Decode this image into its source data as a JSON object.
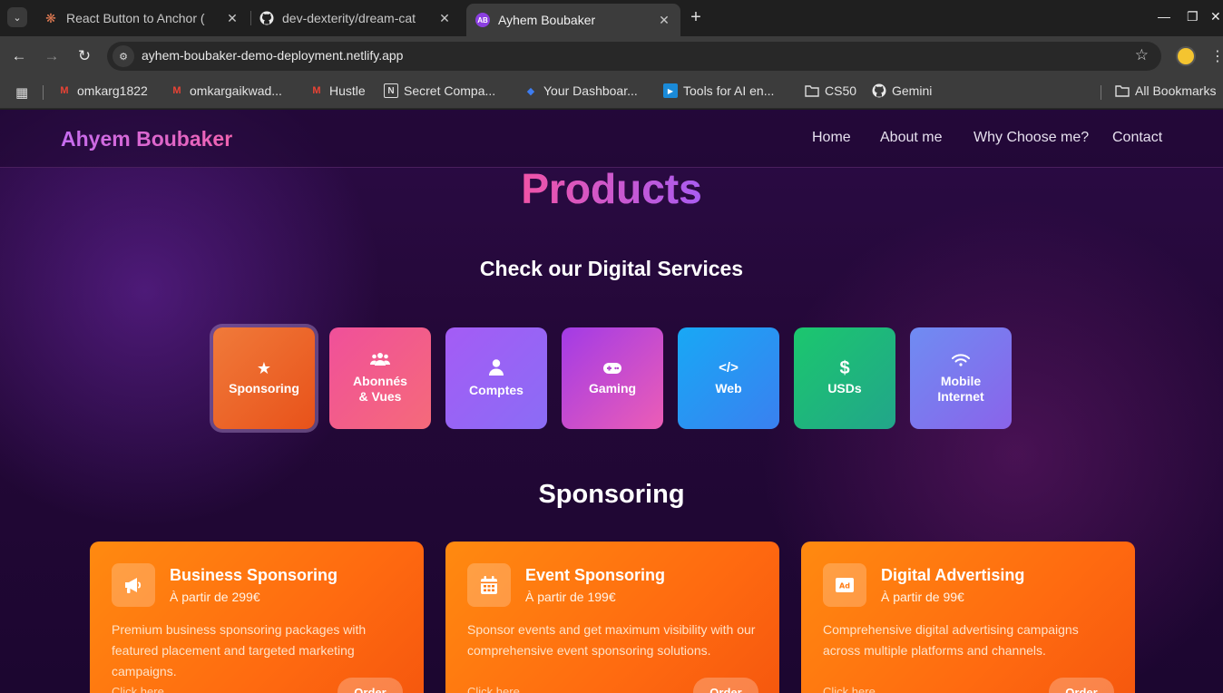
{
  "browser": {
    "tabs": [
      {
        "title": "React Button to Anchor (",
        "favicon": "claude-icon",
        "active": false
      },
      {
        "title": "dev-dexterity/dream-cat",
        "favicon": "github-icon",
        "active": false
      },
      {
        "title": "Ayhem Boubaker",
        "favicon": "AB",
        "active": true
      }
    ],
    "url": "ayhem-boubaker-demo-deployment.netlify.app",
    "bookmarks": [
      {
        "label": "omkarg1822",
        "icon": "gmail-icon"
      },
      {
        "label": "omkargaikwad...",
        "icon": "gmail-icon"
      },
      {
        "label": "Hustle",
        "icon": "gmail-icon"
      },
      {
        "label": "Secret Compa...",
        "icon": "notion-icon"
      },
      {
        "label": "Your Dashboar...",
        "icon": "dashboard-icon"
      },
      {
        "label": "Tools for AI en...",
        "icon": "youtube-icon"
      },
      {
        "label": "CS50",
        "icon": "folder-icon"
      },
      {
        "label": "Gemini",
        "icon": "github-icon"
      }
    ],
    "all_bookmarks": "All Bookmarks"
  },
  "site": {
    "brand": "Ahyem Boubaker",
    "nav": [
      "Home",
      "About me",
      "Why Choose me?",
      "Contact"
    ],
    "products_title": "Products",
    "subtitle": "Check our Digital Services",
    "categories": [
      {
        "label": "Sponsoring",
        "icon": "star-icon",
        "colors": [
          "#f07a3a",
          "#e8521a"
        ]
      },
      {
        "label": "Abonnés & Vues",
        "icon": "users-icon",
        "colors": [
          "#f0509a",
          "#f56a7a"
        ]
      },
      {
        "label": "Comptes",
        "icon": "user-icon",
        "colors": [
          "#a45cf5",
          "#8b6cf5"
        ]
      },
      {
        "label": "Gaming",
        "icon": "gamepad-icon",
        "colors": [
          "#a23be6",
          "#ec5db6"
        ]
      },
      {
        "label": "Web",
        "icon": "code-icon",
        "colors": [
          "#18a8f5",
          "#3a80f0"
        ]
      },
      {
        "label": "USDs",
        "icon": "dollar-icon",
        "colors": [
          "#1bc76e",
          "#22a58a"
        ]
      },
      {
        "label": "Mobile Internet",
        "icon": "wifi-icon",
        "colors": [
          "#6f8cf2",
          "#8a63ea"
        ]
      }
    ],
    "section_title": "Sponsoring",
    "cards": [
      {
        "title": "Business Sponsoring",
        "price": "À partir de 299€",
        "description": "Premium business sponsoring packages with featured placement and targeted marketing campaigns.",
        "link": "Click here",
        "order": "Order",
        "icon": "megaphone-icon"
      },
      {
        "title": "Event Sponsoring",
        "price": "À partir de 199€",
        "description": "Sponsor events and get maximum visibility with our comprehensive event sponsoring solutions.",
        "link": "Click here",
        "order": "Order",
        "icon": "calendar-icon"
      },
      {
        "title": "Digital Advertising",
        "price": "À partir de 99€",
        "description": "Comprehensive digital advertising campaigns across multiple platforms and channels.",
        "link": "Click here",
        "order": "Order",
        "icon": "ad-icon"
      }
    ]
  }
}
